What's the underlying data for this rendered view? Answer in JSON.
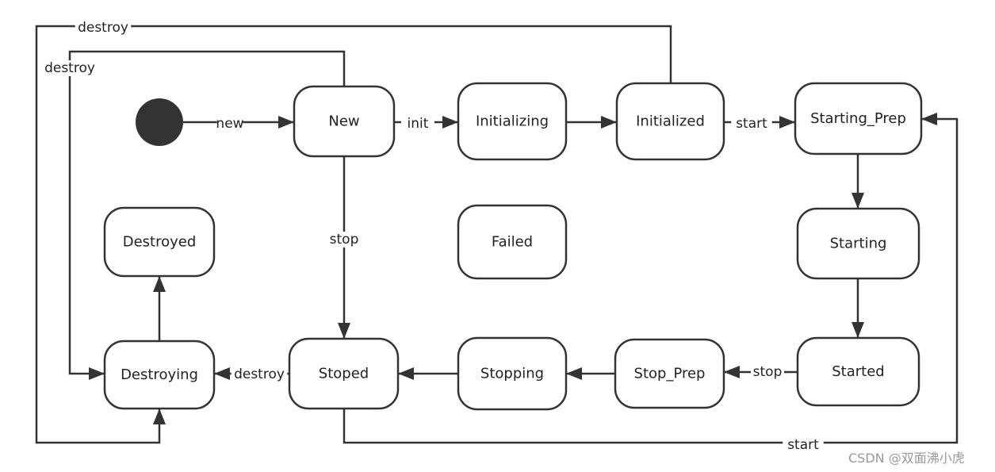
{
  "diagram": {
    "type": "state-machine",
    "colors": {
      "line": "#333333",
      "failed_text": "#f05050",
      "initial_state": "#333333",
      "watermark": "#999999"
    },
    "states": [
      {
        "id": "new",
        "label": "New"
      },
      {
        "id": "initializing",
        "label": "Initializing"
      },
      {
        "id": "initialized",
        "label": "Initialized"
      },
      {
        "id": "starting_prep",
        "label": "Starting_Prep"
      },
      {
        "id": "starting",
        "label": "Starting"
      },
      {
        "id": "started",
        "label": "Started"
      },
      {
        "id": "stop_prep",
        "label": "Stop_Prep"
      },
      {
        "id": "stopping",
        "label": "Stopping"
      },
      {
        "id": "stoped",
        "label": "Stoped"
      },
      {
        "id": "destroying",
        "label": "Destroying"
      },
      {
        "id": "destroyed",
        "label": "Destroyed"
      },
      {
        "id": "failed",
        "label": "Failed"
      }
    ],
    "transitions": [
      {
        "from": "initial",
        "to": "new",
        "label": "new"
      },
      {
        "from": "new",
        "to": "initializing",
        "label": "init"
      },
      {
        "from": "initializing",
        "to": "initialized",
        "label": ""
      },
      {
        "from": "initialized",
        "to": "starting_prep",
        "label": "start"
      },
      {
        "from": "starting_prep",
        "to": "starting",
        "label": ""
      },
      {
        "from": "starting",
        "to": "started",
        "label": ""
      },
      {
        "from": "started",
        "to": "stop_prep",
        "label": "stop"
      },
      {
        "from": "stop_prep",
        "to": "stopping",
        "label": ""
      },
      {
        "from": "stopping",
        "to": "stoped",
        "label": ""
      },
      {
        "from": "stoped",
        "to": "destroying",
        "label": "destroy"
      },
      {
        "from": "destroying",
        "to": "destroyed",
        "label": ""
      },
      {
        "from": "new",
        "to": "stoped",
        "label": "stop"
      },
      {
        "from": "new",
        "to": "destroying",
        "label": "destroy"
      },
      {
        "from": "initialized",
        "to": "destroying",
        "label": "destroy"
      },
      {
        "from": "stoped",
        "to": "starting_prep",
        "label": "start"
      }
    ]
  },
  "watermark": "CSDN @双面沸小虎"
}
